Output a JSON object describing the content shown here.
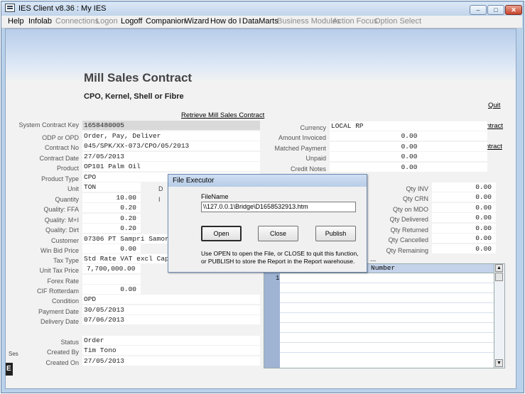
{
  "window": {
    "title": "IES Client v8.36 : My IES",
    "minimize_glyph": "–",
    "maximize_glyph": "□",
    "close_glyph": "✕"
  },
  "menu": [
    {
      "label": "Help",
      "enabled": true
    },
    {
      "label": "Infolab",
      "enabled": true
    },
    {
      "label": "Connections",
      "enabled": false
    },
    {
      "label": "Logon",
      "enabled": false
    },
    {
      "label": "Logoff",
      "enabled": true
    },
    {
      "label": "Companion",
      "enabled": true
    },
    {
      "label": "Wizard",
      "enabled": true
    },
    {
      "label": "How do I",
      "enabled": true
    },
    {
      "label": "DataMarts",
      "enabled": true
    },
    {
      "label": "Business Modules",
      "enabled": false
    },
    {
      "label": "Action Focus",
      "enabled": false
    },
    {
      "label": "Option Select",
      "enabled": false
    }
  ],
  "page": {
    "title": "Mill Sales Contract",
    "subtitle": "CPO, Kernel, Shell or Fibre",
    "retrieve_link": "Retrieve Mill Sales Contract",
    "quit_link": "Quit",
    "delete_link": "Delete Contract",
    "close_link": "Close Contract"
  },
  "left_fields": {
    "system_contract_key": {
      "label": "System Contract Key",
      "value": "1658480005"
    },
    "odp": {
      "label": "ODP or OPD",
      "value": "Order, Pay, Deliver"
    },
    "contract_no": {
      "label": "Contract No",
      "value": "045/SPK/XX-073/CPO/05/2013"
    },
    "contract_date": {
      "label": "Contract Date",
      "value": "27/05/2013"
    },
    "product": {
      "label": "Product",
      "value": "OP101 Palm Oil"
    },
    "product_type": {
      "label": "Product Type",
      "value": "CPO"
    },
    "unit": {
      "label": "Unit",
      "value": "TON"
    },
    "quantity": {
      "label": "Quantity",
      "value": "10.00"
    },
    "quality_ffa": {
      "label": "Quality: FFA",
      "value": "0.20"
    },
    "quality_mi": {
      "label": "Quality: M+I",
      "value": "0.20"
    },
    "quality_dirt": {
      "label": "Quality: Dirt",
      "value": "0.20"
    },
    "customer": {
      "label": "Customer",
      "value": "07306 PT Sampri Samori"
    },
    "win_bid_price": {
      "label": "Win Bid Price",
      "value": "0.00"
    },
    "tax_type": {
      "label": "Tax Type",
      "value": "Std Rate VAT excl Capita"
    },
    "unit_tax_price": {
      "label": "Unit Tax Price",
      "value": "7,700,000.00"
    },
    "forex_rate": {
      "label": "Forex Rate",
      "value": ""
    },
    "cif_rotterdam": {
      "label": "CIF Rotterdam",
      "value": "0.00"
    },
    "condition": {
      "label": "Condition",
      "value": "OPD"
    },
    "payment_date": {
      "label": "Payment Date",
      "value": "30/05/2013"
    },
    "delivery_date": {
      "label": "Delivery Date",
      "value": "07/06/2013"
    },
    "status": {
      "label": "Status",
      "value": "Order"
    },
    "created_by": {
      "label": "Created By",
      "value": "Tim Tono"
    },
    "created_on": {
      "label": "Created On",
      "value": "27/05/2013"
    },
    "partial_label_1": "D",
    "partial_label_2": "I"
  },
  "right_fields": {
    "currency": {
      "label": "Currency",
      "value": "LOCAL RP"
    },
    "amount_invoiced": {
      "label": "Amount Invoiced",
      "value": "0.00"
    },
    "matched_payment": {
      "label": "Matched Payment",
      "value": "0.00"
    },
    "unpaid": {
      "label": "Unpaid",
      "value": "0.00"
    },
    "credit_notes": {
      "label": "Credit Notes",
      "value": "0.00"
    },
    "qty_inv": {
      "label": "Qty INV",
      "value": "0.00"
    },
    "qty_crn": {
      "label": "Qty CRN",
      "value": "0.00"
    },
    "qty_on_mdo": {
      "label": "Qty on MDO",
      "value": "0.00"
    },
    "qty_delivered": {
      "label": "Qty Delivered",
      "value": "0.00"
    },
    "qty_returned": {
      "label": "Qty Returned",
      "value": "0.00"
    },
    "qty_cancelled": {
      "label": "Qty Cancelled",
      "value": "0.00"
    },
    "qty_remaining": {
      "label": "Qty Remaining",
      "value": "0.00"
    }
  },
  "grid": {
    "dots": "...",
    "column_header": "Number",
    "row_number": "1",
    "scroll_up_glyph": "▲",
    "scroll_down_glyph": "▼"
  },
  "session": {
    "label": "Ses",
    "short": "E"
  },
  "dialog": {
    "title": "File Executor",
    "filename_label": "FileName",
    "filename_value": "\\\\127.0.0.1\\Bridge\\D1658532913.htm",
    "open_label": "Open",
    "close_label": "Close",
    "publish_label": "Publish",
    "hint": "Use OPEN to open the File, or CLOSE to quit this function, or PUBLISH to store the Report in the Report warehouse."
  }
}
